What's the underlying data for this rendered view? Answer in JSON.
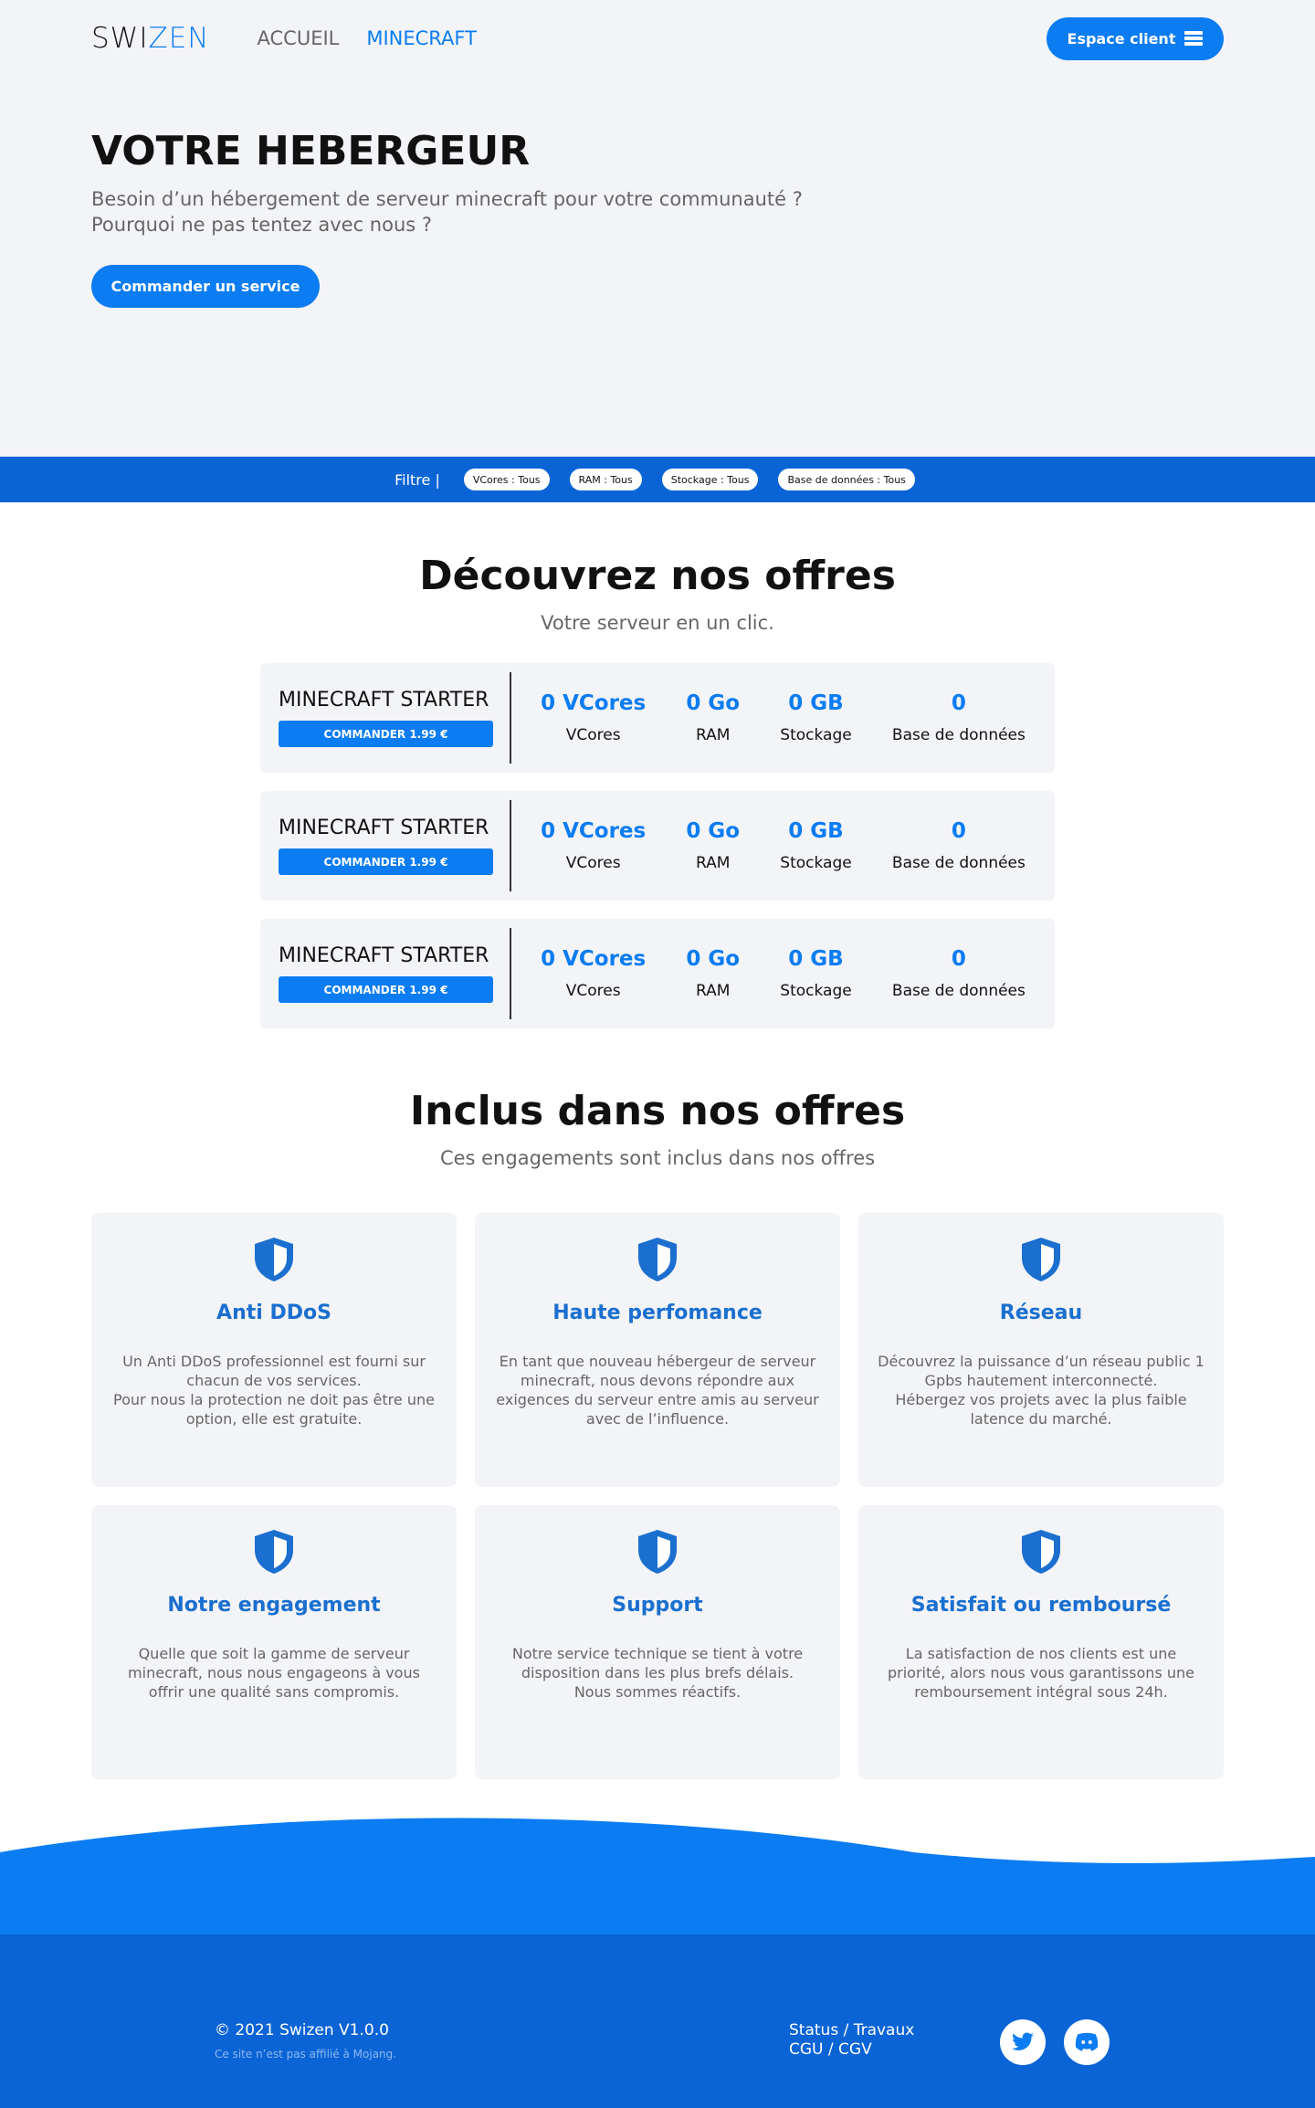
{
  "nav": {
    "logo_part1": "SWI",
    "logo_part2": "ZEN",
    "links": [
      "ACCUEIL",
      "MINECRAFT"
    ],
    "client_button": "Espace client"
  },
  "hero": {
    "title": "VOTRE HEBERGEUR",
    "subtitle_line1": "Besoin d’un hébergement de serveur minecraft pour votre communauté ?",
    "subtitle_line2": "Pourquoi ne pas tentez avec nous ?",
    "cta": "Commander un service"
  },
  "filter": {
    "label": "Filtre |",
    "chips": [
      "VCores : Tous",
      "RAM : Tous",
      "Stockage : Tous",
      "Base de données : Tous"
    ]
  },
  "offers": {
    "title": "Découvrez nos offres",
    "subtitle": "Votre serveur en un clic.",
    "items": [
      {
        "name": "MINECRAFT STARTER",
        "button": "COMMANDER 1.99 €",
        "specs": [
          {
            "value": "0 VCores",
            "label": "VCores"
          },
          {
            "value": "0 Go",
            "label": "RAM"
          },
          {
            "value": "0 GB",
            "label": "Stockage"
          },
          {
            "value": "0",
            "label": "Base de données"
          }
        ]
      },
      {
        "name": "MINECRAFT STARTER",
        "button": "COMMANDER 1.99 €",
        "specs": [
          {
            "value": "0 VCores",
            "label": "VCores"
          },
          {
            "value": "0 Go",
            "label": "RAM"
          },
          {
            "value": "0 GB",
            "label": "Stockage"
          },
          {
            "value": "0",
            "label": "Base de données"
          }
        ]
      },
      {
        "name": "MINECRAFT STARTER",
        "button": "COMMANDER 1.99 €",
        "specs": [
          {
            "value": "0 VCores",
            "label": "VCores"
          },
          {
            "value": "0 Go",
            "label": "RAM"
          },
          {
            "value": "0 GB",
            "label": "Stockage"
          },
          {
            "value": "0",
            "label": "Base de données"
          }
        ]
      }
    ]
  },
  "features": {
    "title": "Inclus dans nos offres",
    "subtitle": "Ces engagements  sont inclus dans nos offres",
    "items": [
      {
        "title": "Anti DDoS",
        "l1": "Un Anti DDoS professionnel est fourni sur",
        "l2": "chacun de vos services.",
        "l3": "Pour nous la protection ne doit pas être une",
        "l4": "option, elle est gratuite."
      },
      {
        "title": "Haute perfomance",
        "l1": "En tant que nouveau hébergeur de serveur",
        "l2": "minecraft, nous devons répondre aux",
        "l3": "exigences du serveur entre amis au serveur",
        "l4": "avec de l’influence."
      },
      {
        "title": "Réseau",
        "l1": "Découvrez la puissance d’un réseau public 1",
        "l2": "Gpbs hautement interconnecté.",
        "l3": "Hébergez vos projets avec la plus faible",
        "l4": "latence du marché."
      },
      {
        "title": "Notre engagement",
        "l1": "Quelle que soit la gamme de serveur",
        "l2": "minecraft, nous nous engageons à vous",
        "l3": "offrir une qualité sans compromis.",
        "l4": ""
      },
      {
        "title": "Support",
        "l1": "Notre service technique se tient à votre",
        "l2": "disposition dans les plus brefs délais.",
        "l3": "Nous sommes réactifs.",
        "l4": ""
      },
      {
        "title": "Satisfait ou remboursé",
        "l1": "La satisfaction de nos clients est une",
        "l2": "priorité, alors nous vous garantissons une",
        "l3": "remboursement intégral sous 24h.",
        "l4": ""
      }
    ]
  },
  "footer": {
    "copyright": "© 2021 Swizen V1.0.0",
    "disclaimer": "Ce site n’est pas affilié à Mojang.",
    "link1": "Status / Travaux",
    "link2": "CGU / CGV",
    "social_icons": [
      "twitter-icon",
      "discord-icon"
    ]
  },
  "colors": {
    "accent": "#0b7cf2",
    "band": "#0a64d6",
    "panel": "#f3f4f7"
  }
}
